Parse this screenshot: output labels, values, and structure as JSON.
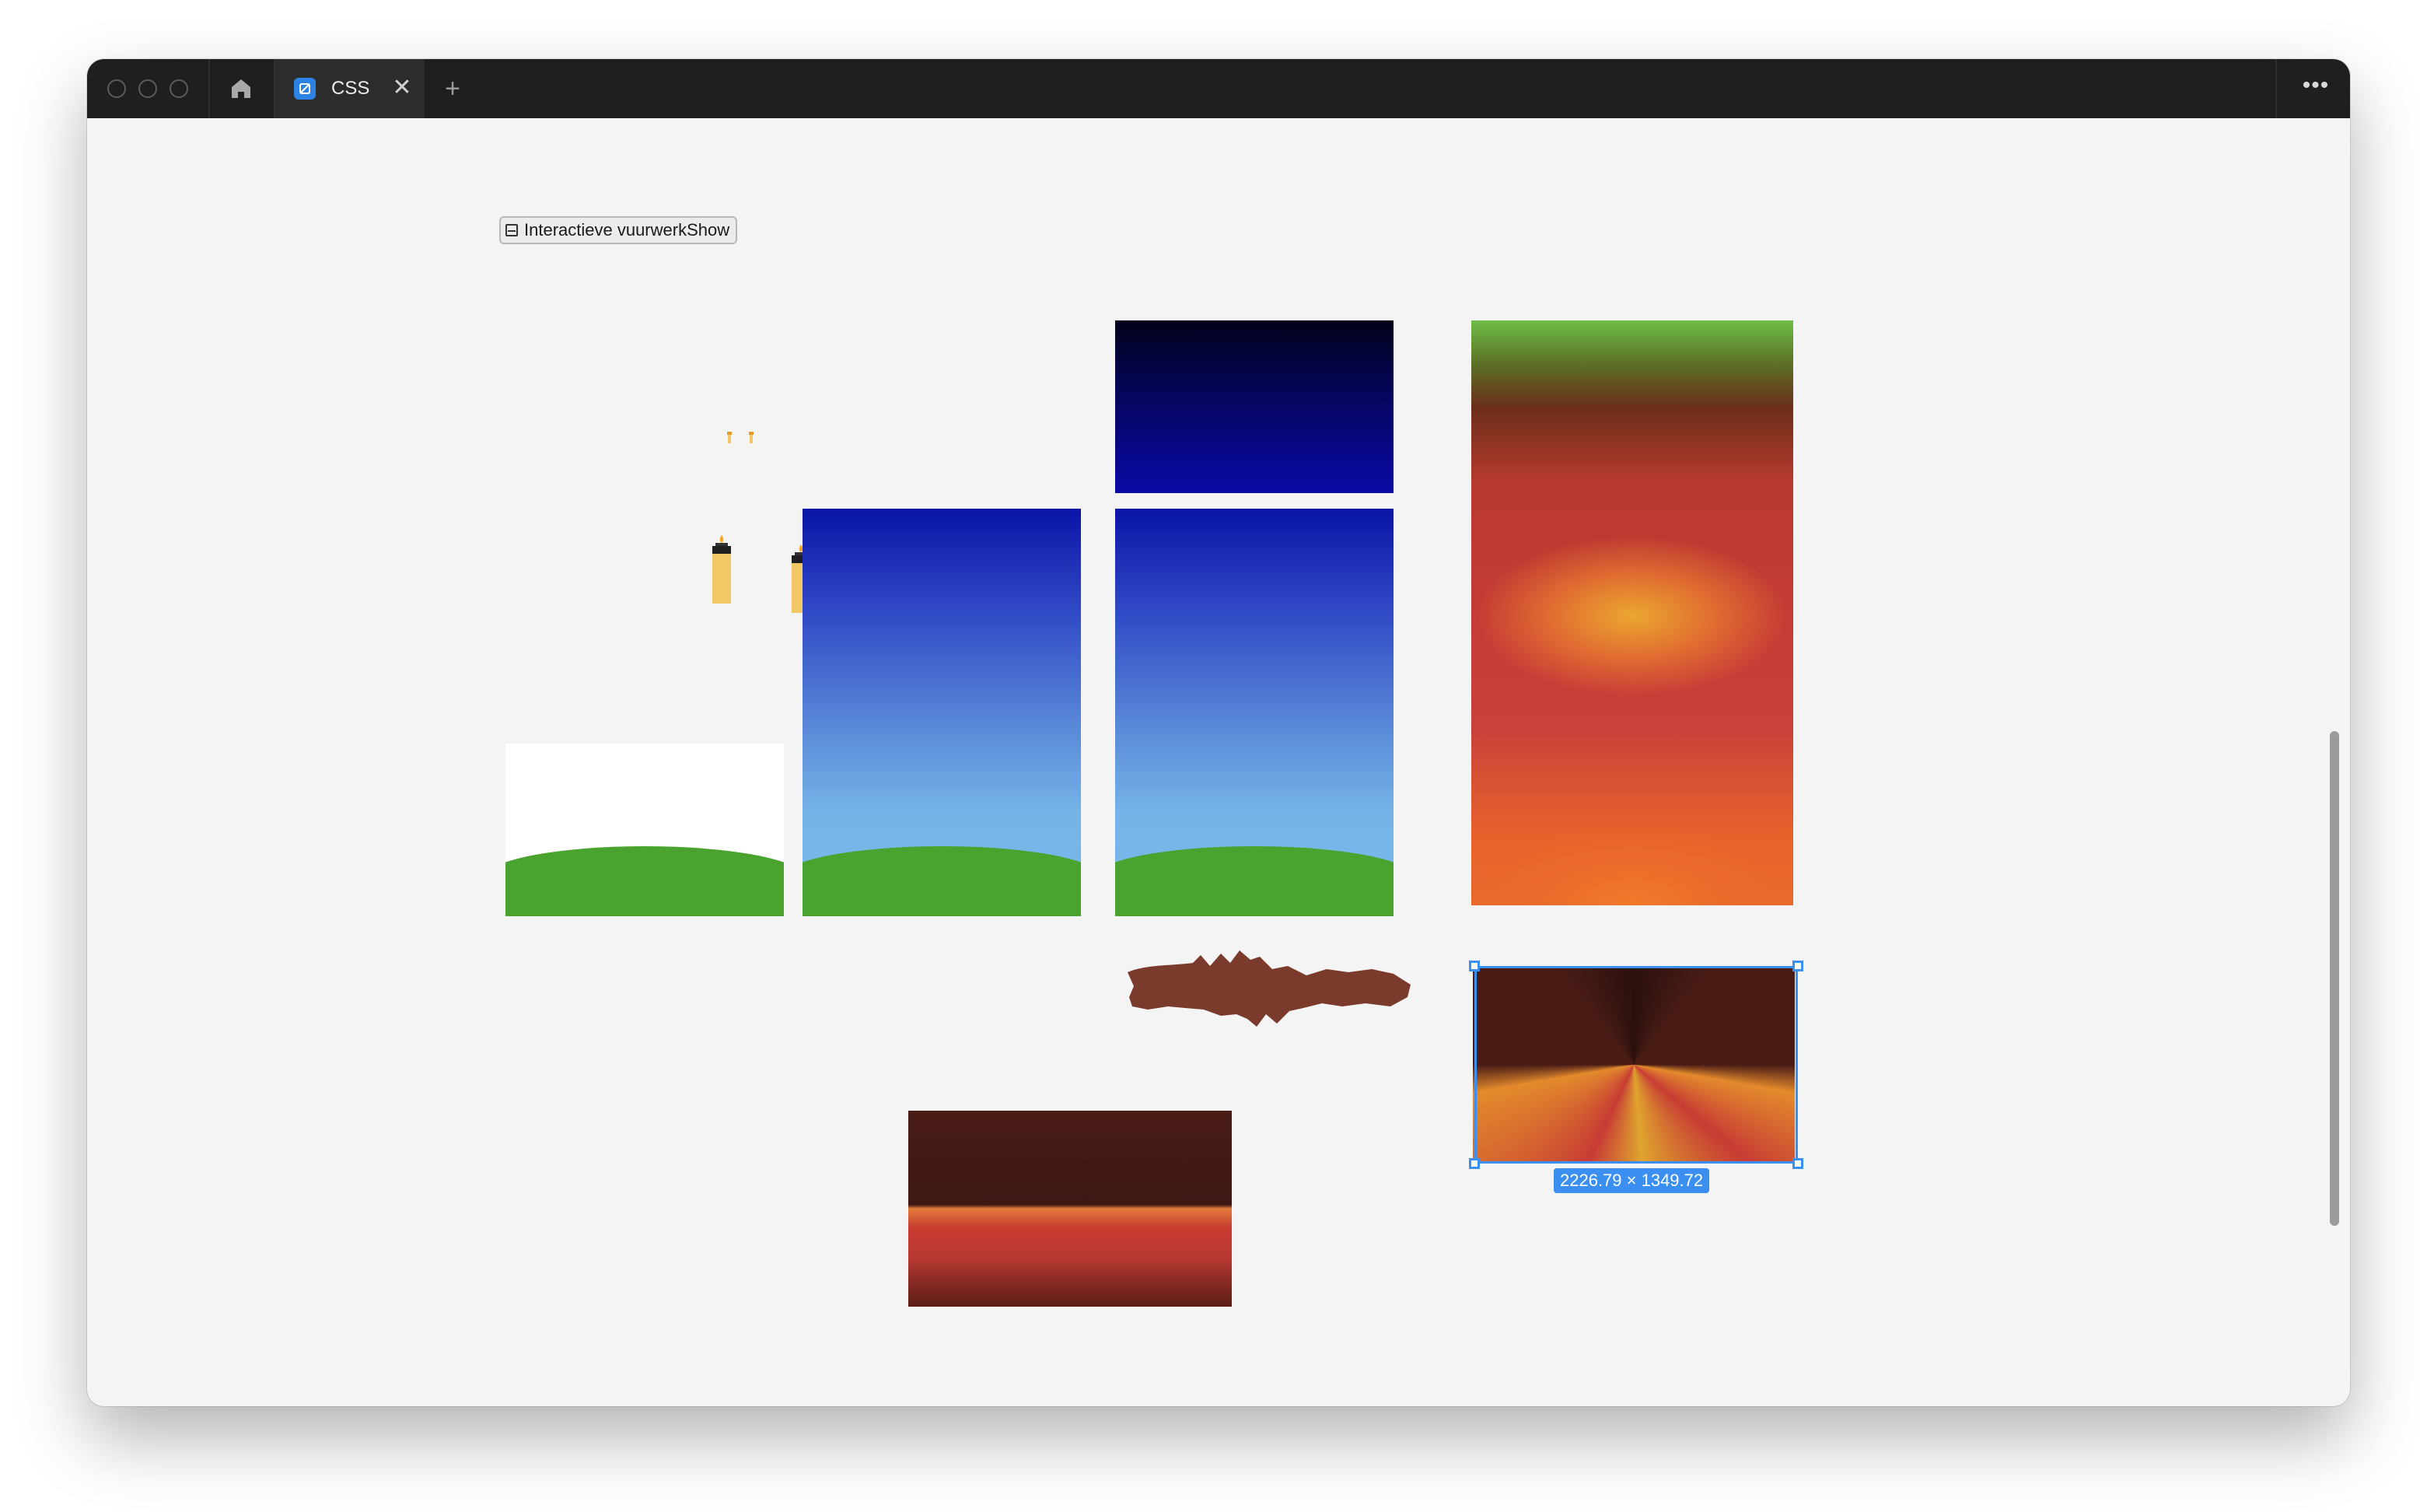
{
  "tab": {
    "label": "CSS"
  },
  "titlebar": {
    "close_glyph": "✕",
    "new_tab_glyph": "+",
    "more_glyph": "•••"
  },
  "canvas": {
    "frame_label": "Interactieve vuurwerkShow",
    "selection_dimensions": "2226.79 × 1349.72"
  },
  "icons": [
    "home-icon",
    "tab-app-icon",
    "close-icon",
    "plus-icon",
    "more-icon",
    "frame-icon"
  ],
  "colors": {
    "selection_accent": "#3a8ff0",
    "titlebar": "#1f1f1f",
    "canvas_background": "#f4f4f4",
    "hill_green": "#49a32e",
    "lighter_body": "#f2c766",
    "rock_brown": "#7a3a2c"
  }
}
